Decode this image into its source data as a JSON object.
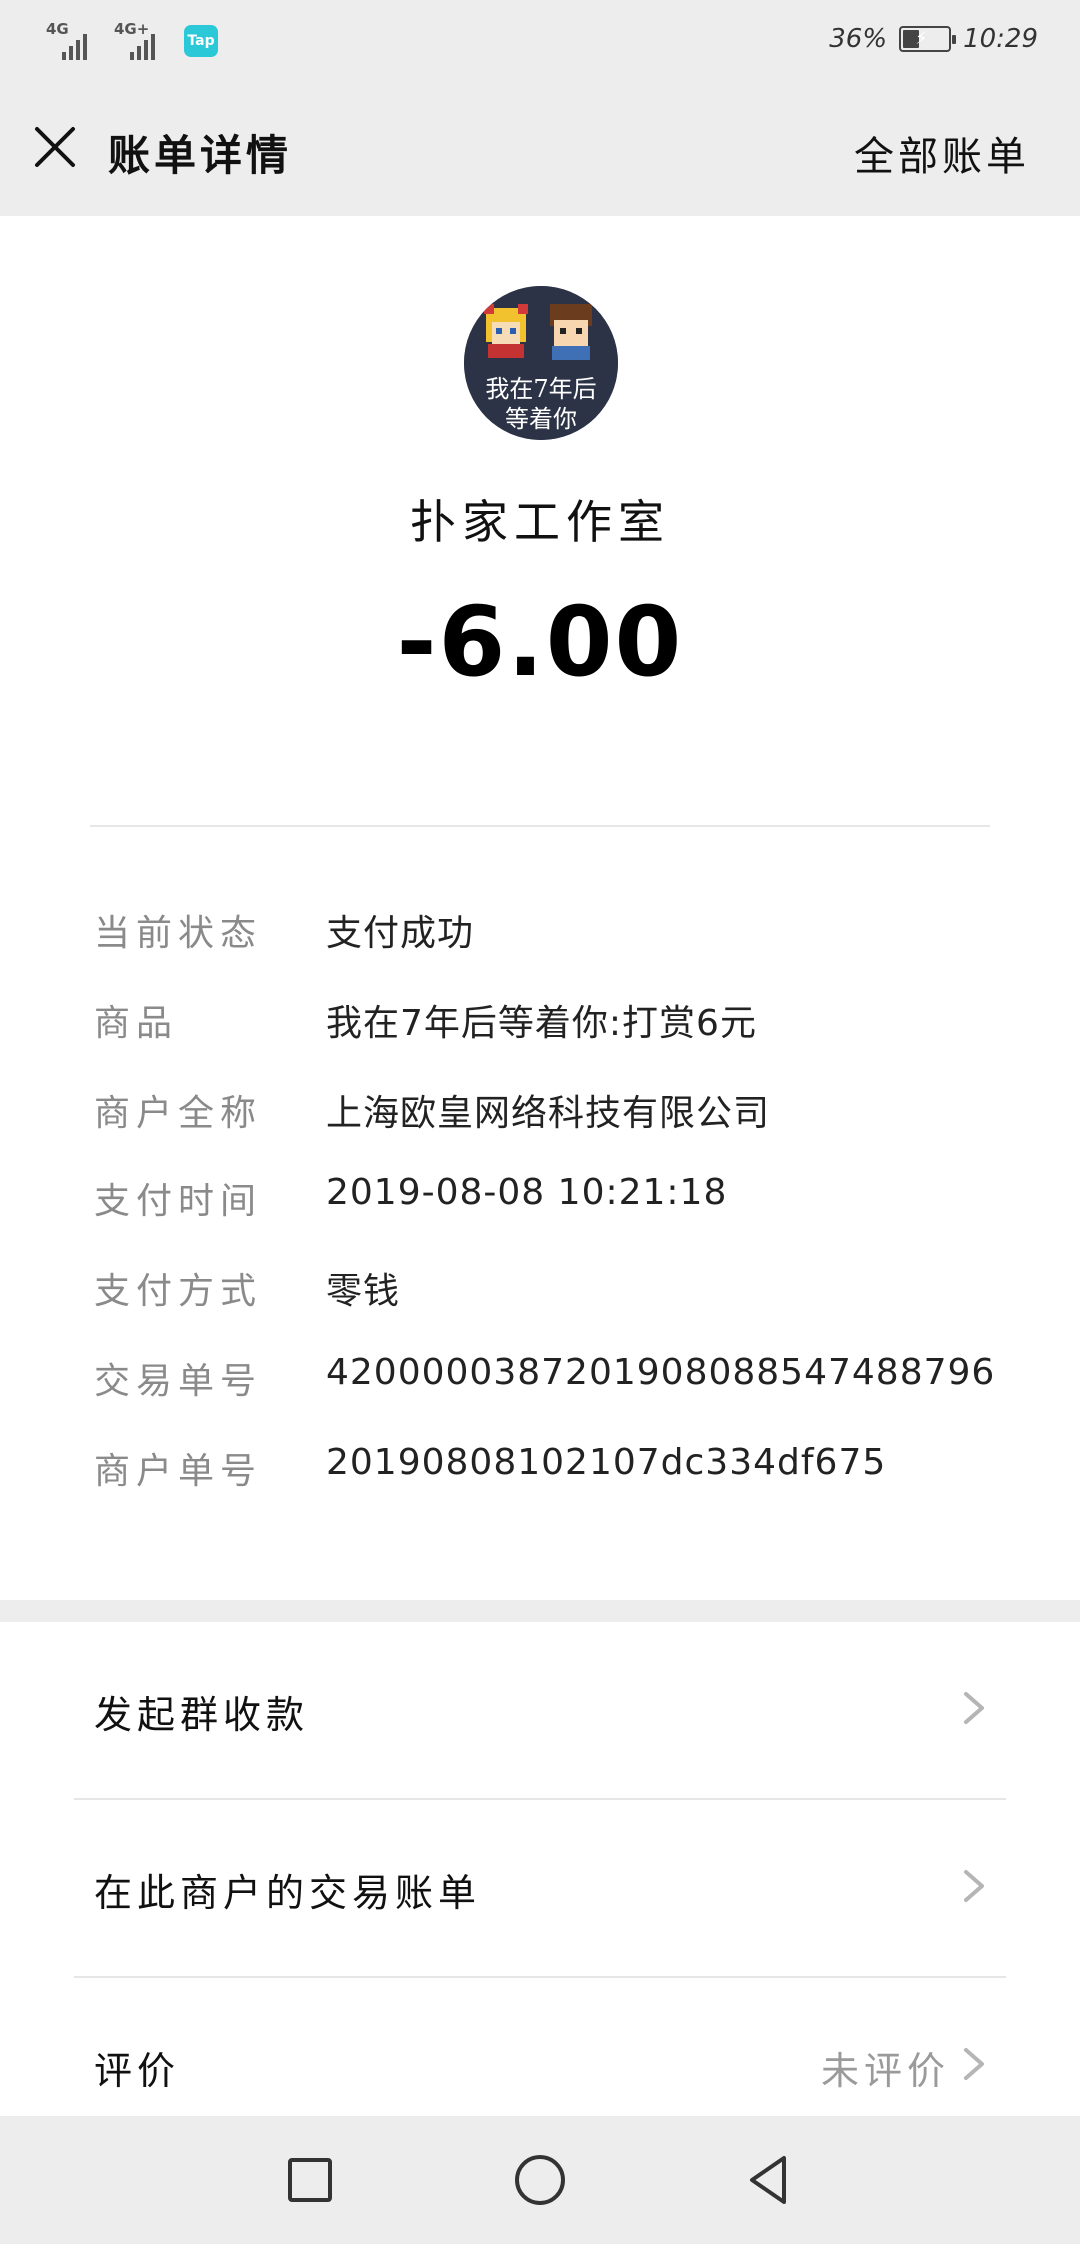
{
  "status_bar": {
    "network_1": "4G",
    "network_2": "4G+",
    "app_badge": "Tap",
    "battery": "36%",
    "battery_level": 0.36,
    "time": "10:29"
  },
  "header": {
    "title": "账单详情",
    "all_bills": "全部账单"
  },
  "avatar": {
    "text": "我在7年后等着你"
  },
  "merchant": {
    "name": "扑家工作室"
  },
  "amount": "-6.00",
  "details": [
    {
      "label": "当前状态",
      "value": "支付成功"
    },
    {
      "label": "商品",
      "value": "我在7年后等着你:打赏6元"
    },
    {
      "label": "商户全称",
      "value": "上海欧皇网络科技有限公司"
    },
    {
      "label": "支付时间",
      "value": "2019-08-08 10:21:18"
    },
    {
      "label": "支付方式",
      "value": "零钱"
    },
    {
      "label": "交易单号",
      "value": "4200000387201908088547488796"
    },
    {
      "label": "商户单号",
      "value": "20190808102107dc334df675"
    }
  ],
  "menu": {
    "group_collect": "发起群收款",
    "merchant_bills": "在此商户的交易账单",
    "review": "评价",
    "review_status": "未评价"
  },
  "colors": {
    "background": "#ededed",
    "card": "#ffffff",
    "label_gray": "#8a8a8a",
    "tap_badge": "#2bc8d8"
  }
}
